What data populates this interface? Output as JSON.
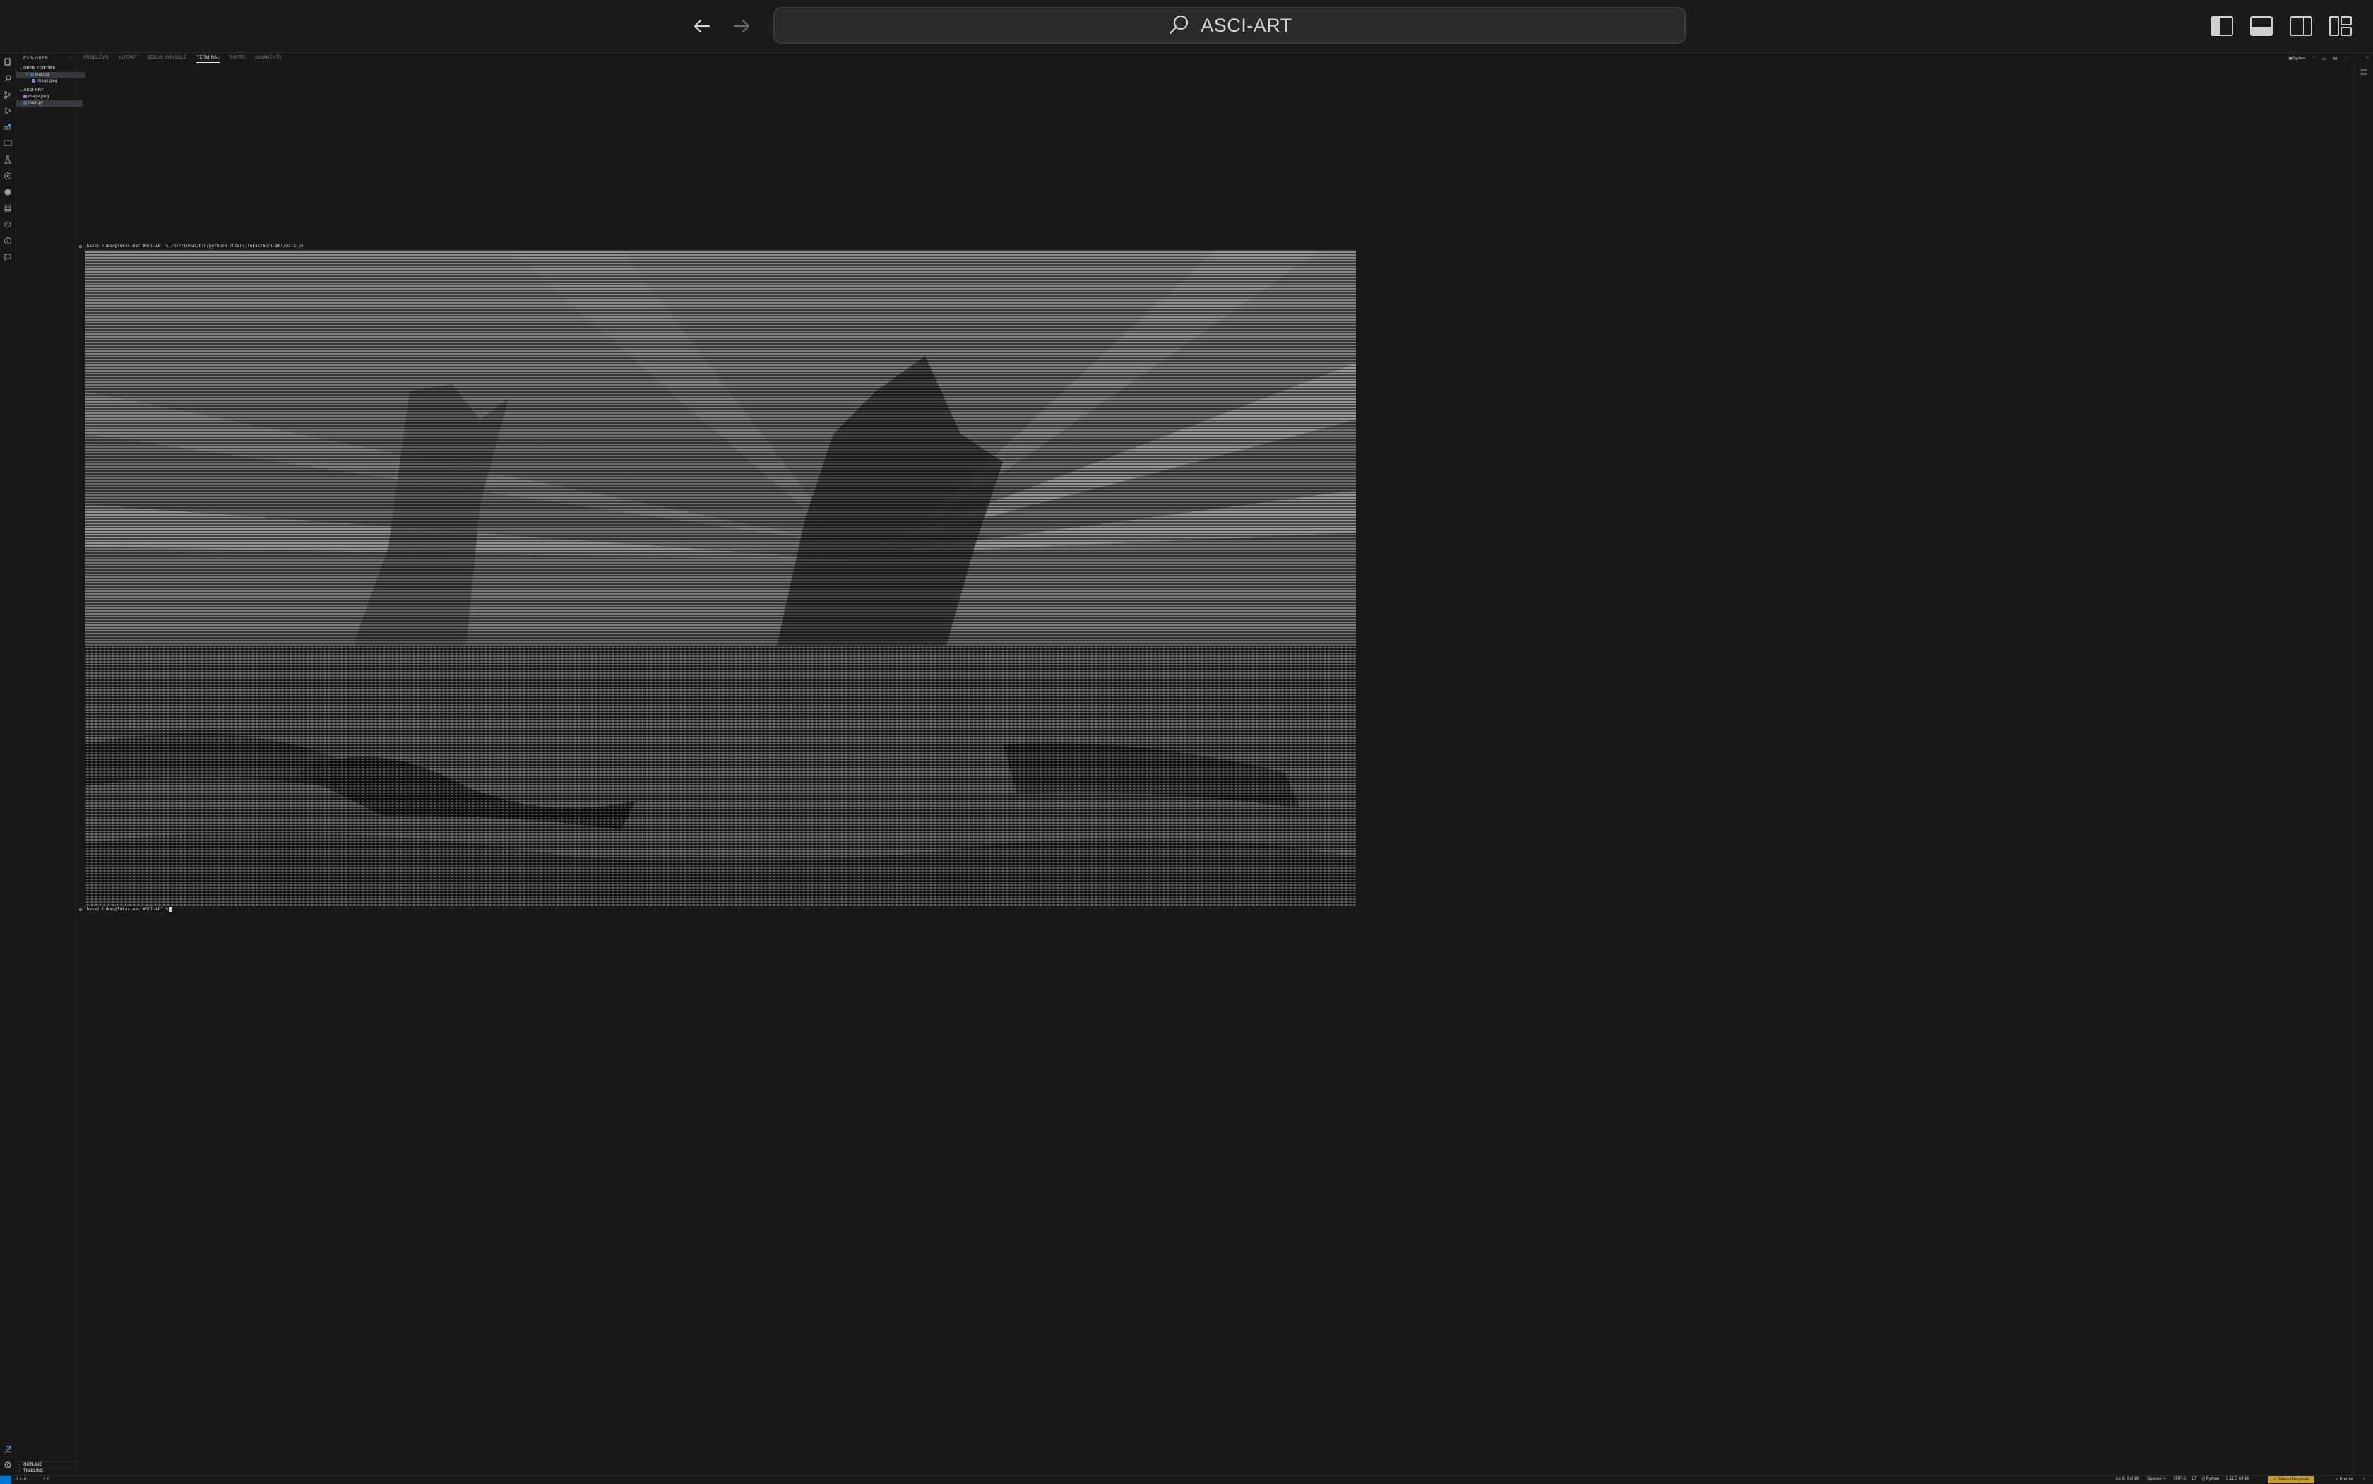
{
  "titlebar": {
    "search_text": "ASCI-ART"
  },
  "sidebar": {
    "title": "EXPLORER",
    "more": "···",
    "sections": [
      {
        "label": "OPEN EDITORS",
        "items": [
          {
            "label": "main.py",
            "selected": true,
            "color": "#3572A5"
          },
          {
            "label": "image.jpeg",
            "selected": false,
            "color": "#a074c4"
          }
        ]
      },
      {
        "label": "ASCI-ART",
        "items": [
          {
            "label": "image.jpeg",
            "selected": false,
            "color": "#a074c4"
          },
          {
            "label": "main.py",
            "selected": true,
            "color": "#3572A5"
          }
        ]
      }
    ],
    "bottom_sections": [
      "OUTLINE",
      "TIMELINE"
    ]
  },
  "panel": {
    "tabs": [
      "PROBLEMS",
      "OUTPUT",
      "DEBUG CONSOLE",
      "TERMINAL",
      "PORTS",
      "COMMENTS"
    ],
    "active_tab": "TERMINAL",
    "shell_label": "Python"
  },
  "terminal": {
    "command_line": "(base) lukas@lukas-mac ASCI-ART % /usr/local/bin/python3 /Users/lukas/ASCI-ART/main.py",
    "prompt_line": "(base) lukas@lukas-mac ASCI-ART %"
  },
  "statusbar": {
    "branch": "0 ⚠ 0",
    "ports": "⎇ 0",
    "position": "Ln 8, Col 18",
    "spaces": "Spaces: 4",
    "encoding": "UTF-8",
    "eol": "LF",
    "language": "{} Python",
    "interpreter": "3.11.5 64-bit",
    "warning": "⚠ Reload Required",
    "prettier": "✓ Prettier"
  },
  "colors": {
    "background": "#181818",
    "accent": "#0078d4",
    "warning": "#c69c24"
  }
}
